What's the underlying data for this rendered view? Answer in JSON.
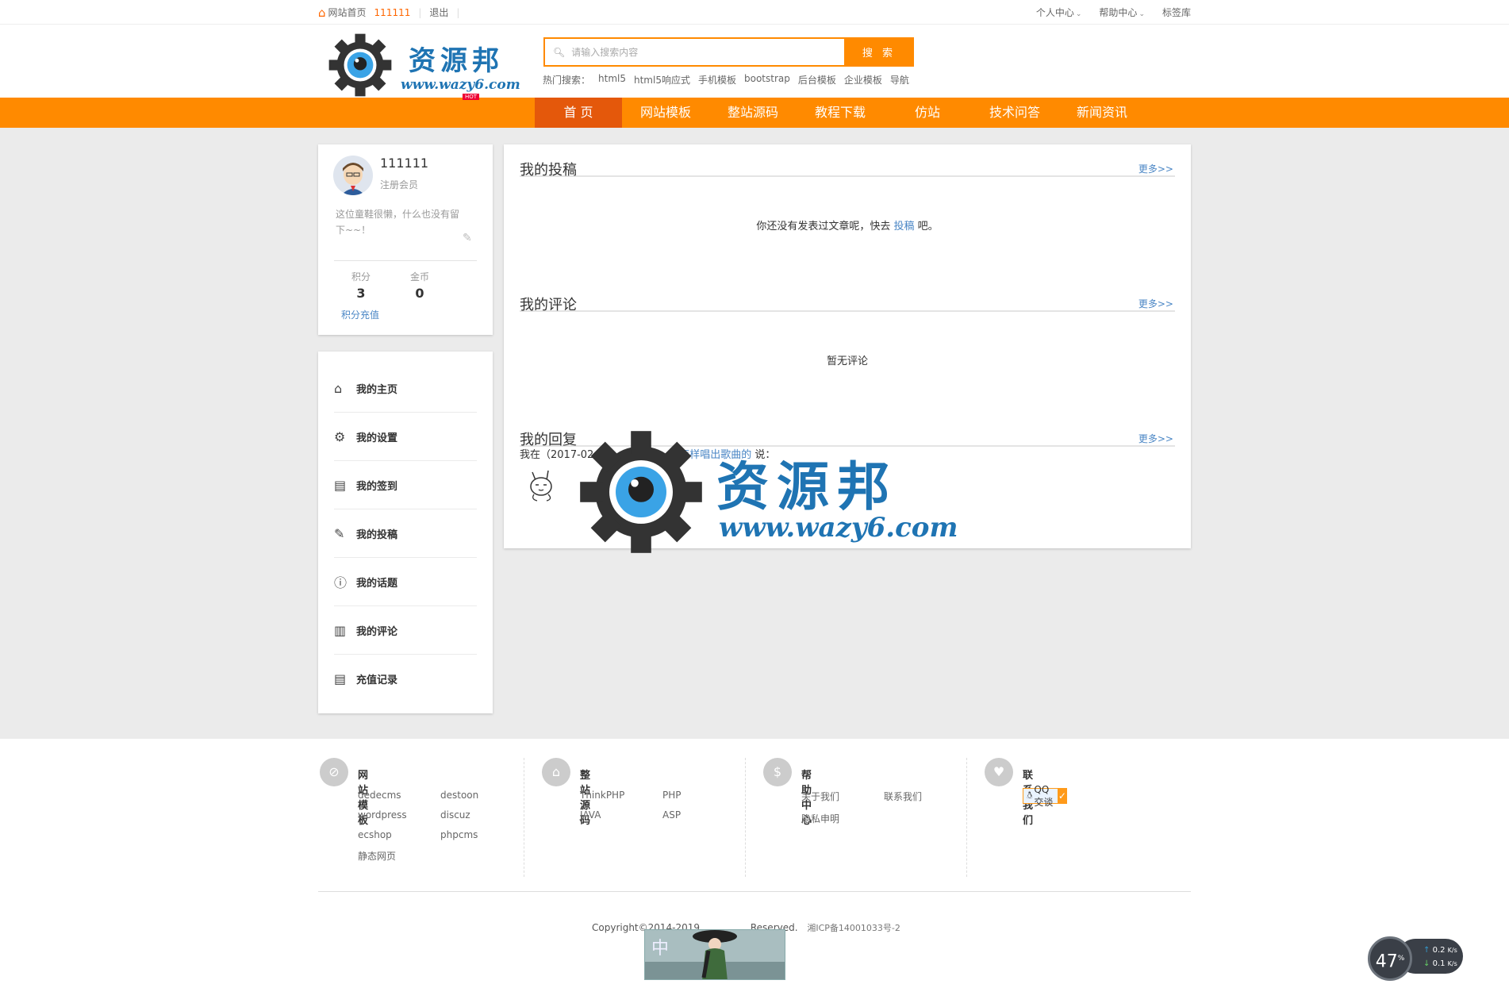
{
  "topbar": {
    "home": "网站首页",
    "username": "111111",
    "logout": "退出",
    "right": [
      "个人中心",
      "帮助中心",
      "标签库"
    ]
  },
  "logo": {
    "text": "资源邦",
    "url": "www.wazy6.com",
    "badge": "HOT"
  },
  "search": {
    "placeholder": "请输入搜索内容",
    "button": "搜 索",
    "hot_label": "热门搜索：",
    "hot_terms": [
      "html5",
      "html5响应式",
      "手机模板",
      "bootstrap",
      "后台模板",
      "企业模板",
      "导航"
    ]
  },
  "nav": {
    "items": [
      "首 页",
      "网站模板",
      "整站源码",
      "教程下载",
      "仿站",
      "技术问答",
      "新闻资讯"
    ],
    "active_index": 0
  },
  "profile": {
    "name": "111111",
    "role": "注册会员",
    "signature": "这位童鞋很懒，什么也没有留下~~！",
    "points_label": "积分",
    "points": "3",
    "coins_label": "金币",
    "coins": "0",
    "recharge": "积分充值"
  },
  "menu": {
    "items": [
      {
        "label": "我的主页",
        "icon": "home-icon"
      },
      {
        "label": "我的设置",
        "icon": "gear-icon"
      },
      {
        "label": "我的签到",
        "icon": "list-icon"
      },
      {
        "label": "我的投稿",
        "icon": "pencil-icon"
      },
      {
        "label": "我的话题",
        "icon": "question-icon"
      },
      {
        "label": "我的评论",
        "icon": "clipboard-icon"
      },
      {
        "label": "充值记录",
        "icon": "list-icon"
      }
    ]
  },
  "sections": {
    "posts": {
      "title": "我的投稿",
      "more": "更多>>",
      "empty_pre": "你还没有发表过文章呢，快去 ",
      "empty_link": "投稿",
      "empty_post": " 吧。"
    },
    "comments": {
      "title": "我的评论",
      "more": "更多>>",
      "empty": "暂无评论"
    },
    "replies": {
      "title": "我的回复",
      "more": "更多>>",
      "line_pre": "我在（2017-02-",
      "line_mid": "12:",
      "line_link": "怎样唱出歌曲的",
      "line_post": " 说："
    }
  },
  "footer": {
    "columns": [
      {
        "title": "网站模板",
        "icon": "compass-icon",
        "links": [
          "dedecms",
          "destoon",
          "wordpress",
          "discuz",
          "ecshop",
          "phpcms",
          "静态网页"
        ]
      },
      {
        "title": "整站源码",
        "icon": "store-icon",
        "links": [
          "ThinkPHP",
          "PHP",
          "JAVA",
          "ASP"
        ]
      },
      {
        "title": "帮助中心",
        "icon": "coin-icon",
        "links": [
          "关于我们",
          "联系我们",
          "隐私申明"
        ]
      },
      {
        "title": "联系我们",
        "icon": "heart-icon",
        "links": []
      }
    ],
    "qq_label": "QQ交谈",
    "copyright": "Copyright©2014-2019",
    "reserved": "Reserved.",
    "icp": "湘ICP备14001033号-2"
  },
  "watermark": {
    "text": "资源邦",
    "url": "www.wazy6.com"
  },
  "speed_widget": {
    "percent": "47",
    "percent_unit": "%",
    "up": "0.2",
    "down": "0.1",
    "unit": "K/s"
  },
  "colors": {
    "accent": "#ff8a00",
    "nav_active": "#e4580b",
    "link": "#4a86c5",
    "logo_blue": "#1f74b3"
  }
}
